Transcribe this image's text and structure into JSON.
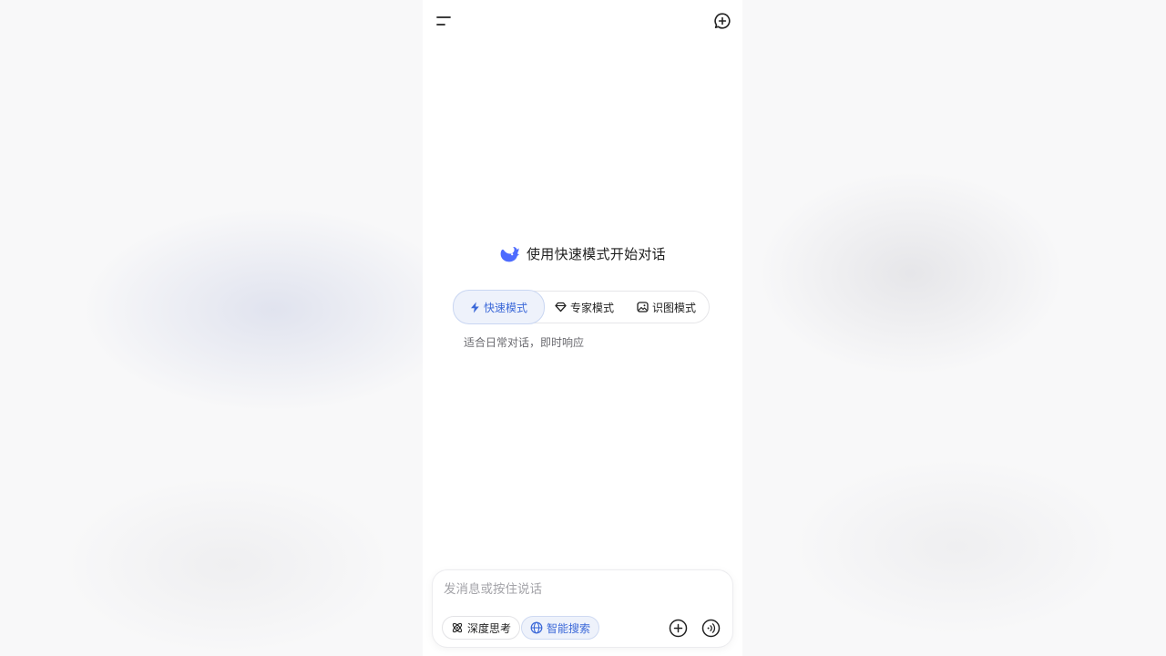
{
  "header": {
    "menu_icon": "menu-icon",
    "new_chat_icon": "new-chat-icon"
  },
  "welcome": {
    "logo_icon": "whale-logo-icon",
    "title": "使用快速模式开始对话"
  },
  "modes": {
    "tabs": [
      {
        "label": "快速模式",
        "icon": "bolt-icon",
        "active": true
      },
      {
        "label": "专家模式",
        "icon": "diamond-icon",
        "active": false
      },
      {
        "label": "识图模式",
        "icon": "image-icon",
        "active": false
      }
    ],
    "description": "适合日常对话，即时响应"
  },
  "composer": {
    "placeholder": "发消息或按住说话",
    "deep_think_label": "深度思考",
    "smart_search_label": "智能搜索",
    "attach_icon": "plus-circle-icon",
    "voice_icon": "voice-icon"
  },
  "colors": {
    "accent": "#3b68d8",
    "active_bg": "#eef2fb",
    "text": "#1f1f1f"
  }
}
